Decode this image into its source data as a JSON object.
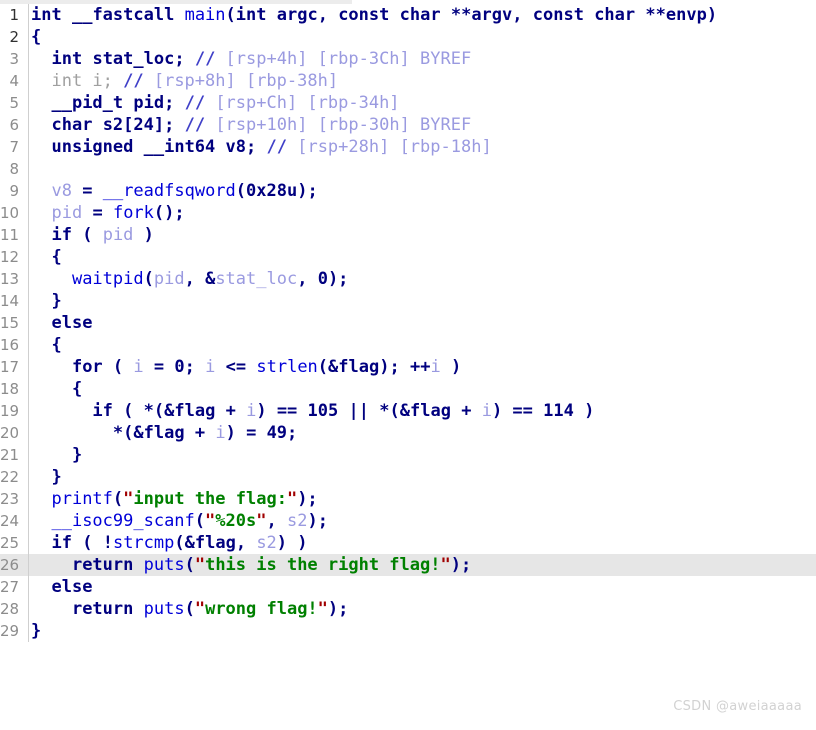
{
  "editor": {
    "kind": "pseudocode-view",
    "highlighted_line": 26,
    "colors": {
      "background": "#ffffff",
      "gutter_text": "#8c8c8c",
      "highlight": "#e6e6e6",
      "keyword": "#00007f",
      "function": "#0000d8",
      "variable": "#9a9ae0",
      "string": "#008000",
      "quote": "#a00000",
      "comment": "#9a9ae0",
      "dimmed": "#a0a0a0",
      "watermark": "#d2d2d2"
    }
  },
  "watermark": {
    "text": "CSDN @aweiaaaaa"
  },
  "lines": [
    {
      "n": "1",
      "text": "int __fastcall main(int argc, const char **argv, const char **envp)"
    },
    {
      "n": "2",
      "text": "{"
    },
    {
      "n": "3",
      "text": "  int stat_loc; // [rsp+4h] [rbp-3Ch] BYREF"
    },
    {
      "n": "4",
      "text": "  int i; // [rsp+8h] [rbp-38h]"
    },
    {
      "n": "5",
      "text": "  __pid_t pid; // [rsp+Ch] [rbp-34h]"
    },
    {
      "n": "6",
      "text": "  char s2[24]; // [rsp+10h] [rbp-30h] BYREF"
    },
    {
      "n": "7",
      "text": "  unsigned __int64 v8; // [rsp+28h] [rbp-18h]"
    },
    {
      "n": "8",
      "text": ""
    },
    {
      "n": "9",
      "text": "  v8 = __readfsqword(0x28u);"
    },
    {
      "n": "10",
      "text": "  pid = fork();"
    },
    {
      "n": "11",
      "text": "  if ( pid )"
    },
    {
      "n": "12",
      "text": "  {"
    },
    {
      "n": "13",
      "text": "    waitpid(pid, &stat_loc, 0);"
    },
    {
      "n": "14",
      "text": "  }"
    },
    {
      "n": "15",
      "text": "  else"
    },
    {
      "n": "16",
      "text": "  {"
    },
    {
      "n": "17",
      "text": "    for ( i = 0; i <= strlen(&flag); ++i )"
    },
    {
      "n": "18",
      "text": "    {"
    },
    {
      "n": "19",
      "text": "      if ( *(&flag + i) == 105 || *(&flag + i) == 114 )"
    },
    {
      "n": "20",
      "text": "        *(&flag + i) = 49;"
    },
    {
      "n": "21",
      "text": "    }"
    },
    {
      "n": "22",
      "text": "  }"
    },
    {
      "n": "23",
      "text": "  printf(\"input the flag:\");"
    },
    {
      "n": "24",
      "text": "  __isoc99_scanf(\"%20s\", s2);"
    },
    {
      "n": "25",
      "text": "  if ( !strcmp(&flag, s2) )"
    },
    {
      "n": "26",
      "text": "    return puts(\"this is the right flag!\");"
    },
    {
      "n": "27",
      "text": "  else"
    },
    {
      "n": "28",
      "text": "    return puts(\"wrong flag!\");"
    },
    {
      "n": "29",
      "text": "}"
    }
  ]
}
